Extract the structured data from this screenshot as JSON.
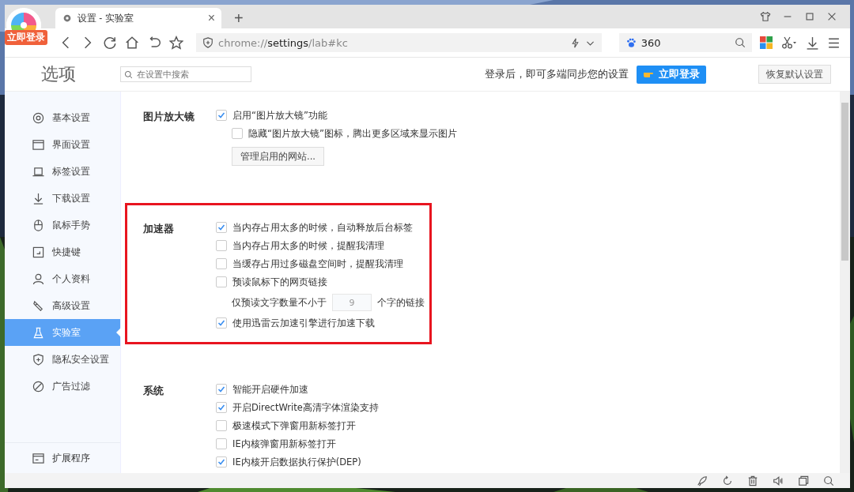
{
  "browser": {
    "login_badge": "立即登录",
    "tab": {
      "title": "设置 - 实验室",
      "close": "×"
    },
    "new_tab": "+",
    "address": {
      "scheme": "chrome://",
      "host": "settings",
      "path": "/lab#kc"
    },
    "search_box": {
      "value": "360"
    }
  },
  "header": {
    "title": "选项",
    "search": {
      "placeholder": "在设置中搜索"
    },
    "sync_text": "登录后，即可多端同步您的设置",
    "login_button": "立即登录",
    "reset_button": "恢复默认设置"
  },
  "sidebar": {
    "items": [
      {
        "label": "基本设置",
        "selected": false
      },
      {
        "label": "界面设置",
        "selected": false
      },
      {
        "label": "标签设置",
        "selected": false
      },
      {
        "label": "下载设置",
        "selected": false
      },
      {
        "label": "鼠标手势",
        "selected": false
      },
      {
        "label": "快捷键",
        "selected": false
      },
      {
        "label": "个人资料",
        "selected": false
      },
      {
        "label": "高级设置",
        "selected": false
      },
      {
        "label": "实验室",
        "selected": true
      },
      {
        "label": "隐私安全设置",
        "selected": false
      },
      {
        "label": "广告过滤",
        "selected": false
      }
    ],
    "footer": {
      "label": "扩展程序"
    }
  },
  "sections": [
    {
      "title": "图片放大镜",
      "highlighted": false,
      "rows": [
        {
          "kind": "checkbox",
          "label": "启用“图片放大镜”功能",
          "checked": true
        },
        {
          "kind": "subcheckbox",
          "label": "隐藏“图片放大镜”图标，腾出更多区域来显示图片",
          "checked": false
        },
        {
          "kind": "button",
          "label": "管理启用的网站..."
        }
      ]
    },
    {
      "title": "加速器",
      "highlighted": true,
      "rows": [
        {
          "kind": "checkbox",
          "label": "当内存占用太多的时候，自动释放后台标签",
          "checked": true
        },
        {
          "kind": "checkbox",
          "label": "当内存占用太多的时候，提醒我清理",
          "checked": false
        },
        {
          "kind": "checkbox",
          "label": "当缓存占用过多磁盘空间时，提醒我清理",
          "checked": false
        },
        {
          "kind": "checkbox",
          "label": "预读鼠标下的网页链接",
          "checked": false
        },
        {
          "kind": "number",
          "before": "仅预读文字数量不小于",
          "value": "9",
          "after": "个字的链接"
        },
        {
          "kind": "checkbox",
          "label": "使用迅雷云加速引擎进行加速下载",
          "checked": true
        }
      ]
    },
    {
      "title": "系统",
      "highlighted": false,
      "rows": [
        {
          "kind": "checkbox",
          "label": "智能开启硬件加速",
          "checked": true
        },
        {
          "kind": "checkbox",
          "label": "开启DirectWrite高清字体渲染支持",
          "checked": true
        },
        {
          "kind": "checkbox",
          "label": "极速模式下弹窗用新标签打开",
          "checked": false
        },
        {
          "kind": "checkbox",
          "label": "IE内核弹窗用新标签打开",
          "checked": false
        },
        {
          "kind": "checkbox",
          "label": "IE内核开启数据执行保护(DEP)",
          "checked": true
        }
      ]
    }
  ]
}
